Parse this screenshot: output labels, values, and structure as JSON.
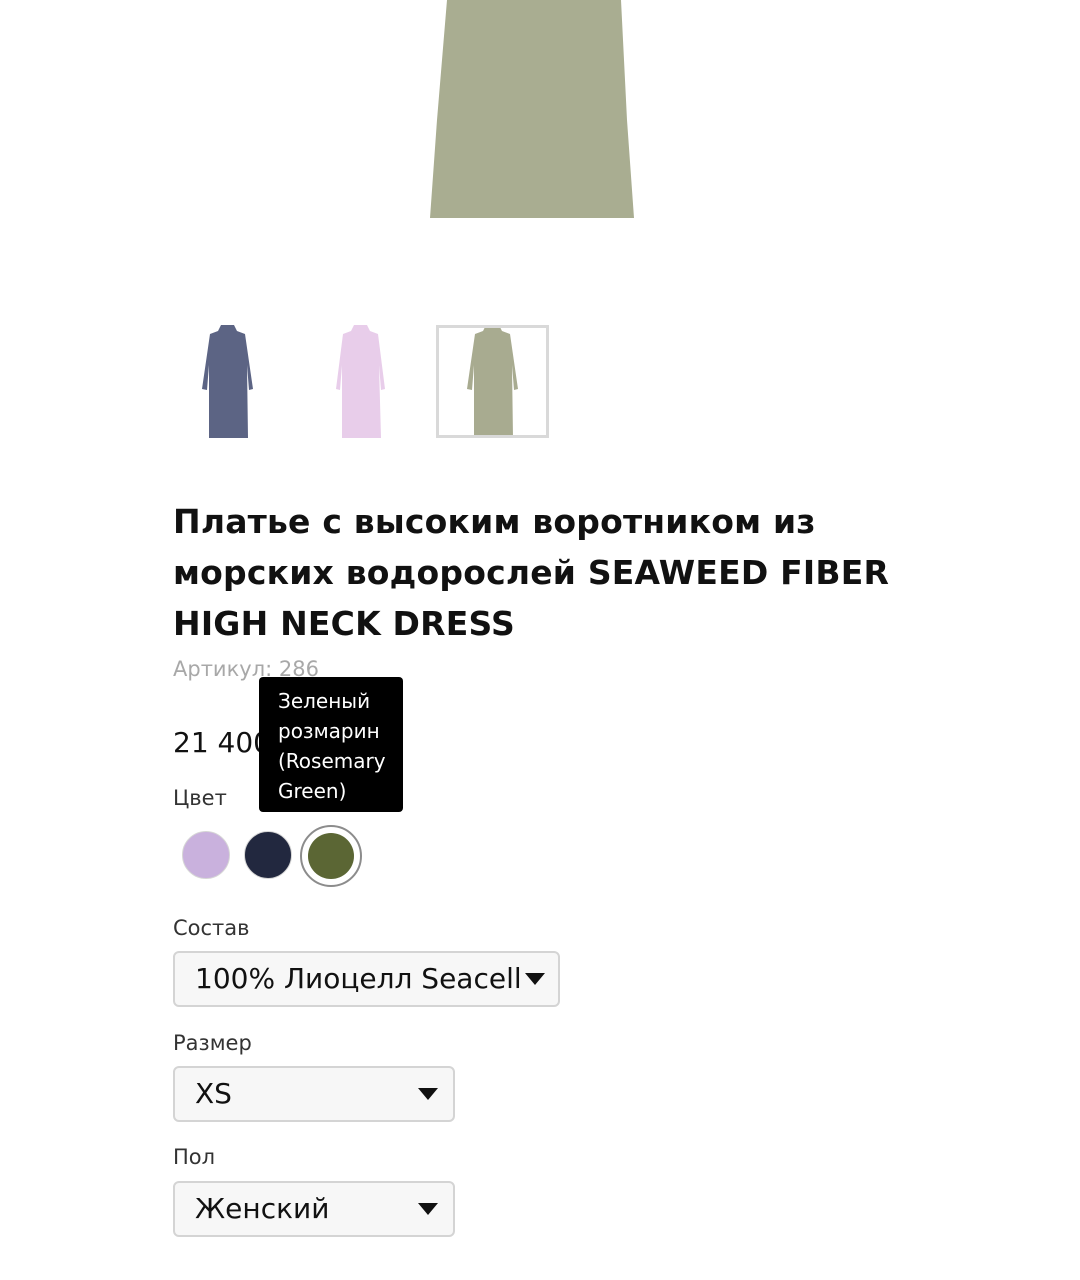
{
  "product": {
    "title": "Платье с высоким воротником из морских водорослей SEAWEED FIBER HIGH NECK DRESS",
    "sku": "Артикул: 286",
    "price": "21 400"
  },
  "colors": {
    "accent": "#000000",
    "swatch_lavender": "#c9b1dd",
    "swatch_navy": "#22283f",
    "swatch_green": "#5b6634",
    "dress_main": "#a9ad91",
    "thumb_navy": "#5c6484",
    "thumb_lilac": "#e8cdea",
    "thumb_green": "#a8ab90"
  },
  "thumbnails": [
    {
      "name": "dress-navy-thumbnail",
      "selected": false
    },
    {
      "name": "dress-lilac-thumbnail",
      "selected": false
    },
    {
      "name": "dress-green-thumbnail",
      "selected": true
    }
  ],
  "color_picker": {
    "label": "Цвет",
    "tooltip_lines": [
      "Зеленый",
      "розмарин",
      "(Rosemary",
      "Green)"
    ],
    "options": [
      "lavender",
      "navy",
      "rosemary-green"
    ],
    "selected": "rosemary-green"
  },
  "composition": {
    "label": "Состав",
    "value": "100% Лиоцелл Seacell"
  },
  "size": {
    "label": "Размер",
    "value": "XS"
  },
  "gender": {
    "label": "Пол",
    "value": "Женский"
  }
}
